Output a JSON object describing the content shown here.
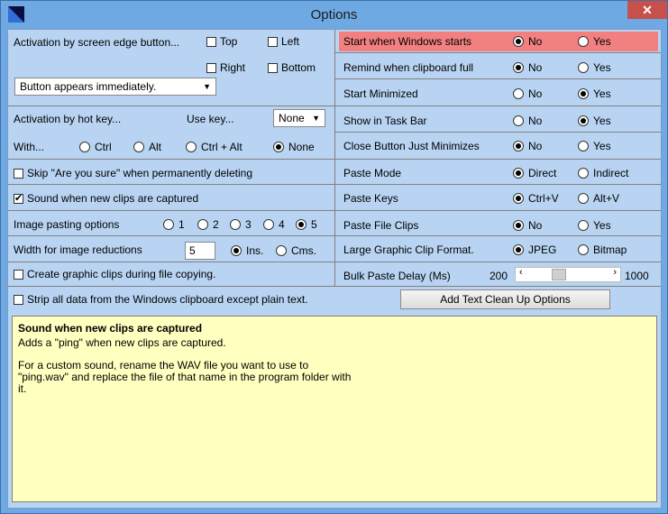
{
  "window": {
    "title": "Options",
    "close_label": "✕"
  },
  "left": {
    "screen_edge": {
      "label": "Activation by screen edge button...",
      "top": {
        "label": "Top",
        "checked": false
      },
      "left": {
        "label": "Left",
        "checked": false
      },
      "right": {
        "label": "Right",
        "checked": false
      },
      "bottom": {
        "label": "Bottom",
        "checked": false
      },
      "appear_select": "Button appears immediately."
    },
    "hotkey": {
      "label": "Activation by hot key...",
      "use_key_label": "Use key...",
      "use_key_value": "None",
      "with_label": "With...",
      "options": [
        "Ctrl",
        "Alt",
        "Ctrl + Alt",
        "None"
      ],
      "selected": "None"
    },
    "skip_sure": {
      "label": "Skip \"Are you sure\" when permanently deleting",
      "checked": false
    },
    "sound": {
      "label": "Sound when new clips are captured",
      "checked": true
    },
    "image_paste": {
      "label": "Image pasting options",
      "options": [
        "1",
        "2",
        "3",
        "4",
        "5"
      ],
      "selected": "5"
    },
    "width_reduce": {
      "label": "Width for image reductions",
      "value": "5",
      "units": [
        "Ins.",
        "Cms."
      ],
      "selected": "Ins."
    },
    "graphic_clips": {
      "label": "Create graphic clips during file copying.",
      "checked": false
    },
    "strip": {
      "label": "Strip all data from the Windows clipboard except plain text.",
      "checked": false
    }
  },
  "right": {
    "rows": [
      {
        "label": "Start when Windows starts",
        "a": "No",
        "b": "Yes",
        "selected": "a"
      },
      {
        "label": "Remind when clipboard full",
        "a": "No",
        "b": "Yes",
        "selected": "a"
      },
      {
        "label": "Start Minimized",
        "a": "No",
        "b": "Yes",
        "selected": "b"
      },
      {
        "label": "Show in Task Bar",
        "a": "No",
        "b": "Yes",
        "selected": "b"
      },
      {
        "label": "Close Button Just Minimizes",
        "a": "No",
        "b": "Yes",
        "selected": "a"
      },
      {
        "label": "Paste Mode",
        "a": "Direct",
        "b": "Indirect",
        "selected": "a"
      },
      {
        "label": "Paste Keys",
        "a": "Ctrl+V",
        "b": "Alt+V",
        "selected": "a"
      },
      {
        "label": "Paste File Clips",
        "a": "No",
        "b": "Yes",
        "selected": "a"
      },
      {
        "label": "Large Graphic Clip Format.",
        "a": "JPEG",
        "b": "Bitmap",
        "selected": "a"
      }
    ],
    "bulk_delay": {
      "label": "Bulk Paste Delay (Ms)",
      "min": "200",
      "max": "1000",
      "value": 0.35
    },
    "cleanup_button": "Add Text Clean Up Options"
  },
  "help": {
    "title": "Sound when new clips are captured",
    "line1": "Adds a \"ping\" when new clips are captured.",
    "line2": "For a custom sound, rename the WAV file you want to use to",
    "line3": "\"ping.wav\" and replace the file of that name in the program folder with",
    "line4": "it."
  },
  "colors": {
    "highlight": "#f28080",
    "client_bg": "#b8d4f2",
    "help_bg": "#ffffc0"
  }
}
